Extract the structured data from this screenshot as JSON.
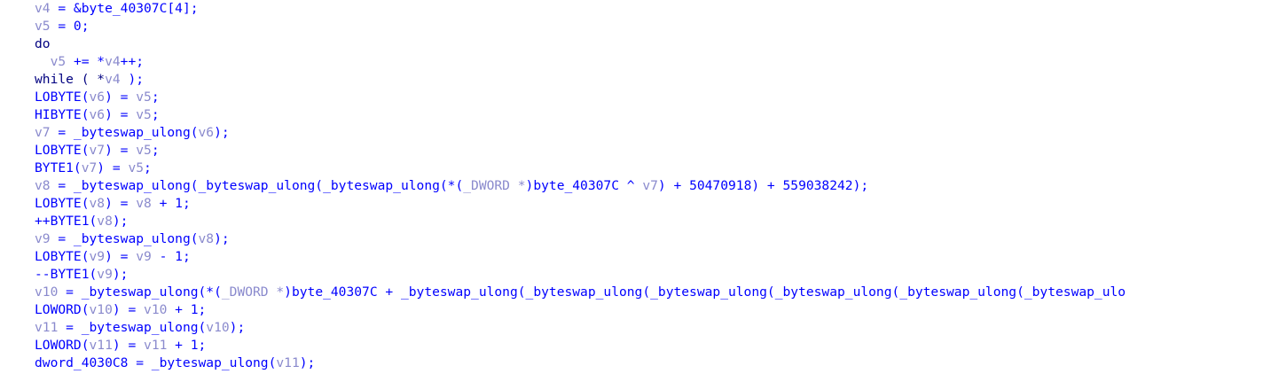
{
  "pseudocode": {
    "lines": [
      {
        "indent": "",
        "tokens": [
          {
            "t": "v4",
            "k": "local"
          },
          {
            "t": " = &byte_40307C[4];",
            "k": "var"
          }
        ]
      },
      {
        "indent": "",
        "tokens": [
          {
            "t": "v5",
            "k": "local"
          },
          {
            "t": " = 0;",
            "k": "var"
          }
        ]
      },
      {
        "indent": "",
        "tokens": [
          {
            "t": "do",
            "k": "kw"
          }
        ]
      },
      {
        "indent": "  ",
        "tokens": [
          {
            "t": "v5",
            "k": "local"
          },
          {
            "t": " += *",
            "k": "var"
          },
          {
            "t": "v4",
            "k": "local"
          },
          {
            "t": "++;",
            "k": "var"
          }
        ]
      },
      {
        "indent": "",
        "tokens": [
          {
            "t": "while ( *",
            "k": "kw"
          },
          {
            "t": "v4",
            "k": "local"
          },
          {
            "t": " );",
            "k": "var"
          }
        ]
      },
      {
        "indent": "",
        "tokens": [
          {
            "t": "LOBYTE(",
            "k": "var"
          },
          {
            "t": "v6",
            "k": "local"
          },
          {
            "t": ") = ",
            "k": "var"
          },
          {
            "t": "v5",
            "k": "local"
          },
          {
            "t": ";",
            "k": "var"
          }
        ]
      },
      {
        "indent": "",
        "tokens": [
          {
            "t": "HIBYTE(",
            "k": "var"
          },
          {
            "t": "v6",
            "k": "local"
          },
          {
            "t": ") = ",
            "k": "var"
          },
          {
            "t": "v5",
            "k": "local"
          },
          {
            "t": ";",
            "k": "var"
          }
        ]
      },
      {
        "indent": "",
        "tokens": [
          {
            "t": "v7",
            "k": "local"
          },
          {
            "t": " = _byteswap_ulong(",
            "k": "var"
          },
          {
            "t": "v6",
            "k": "local"
          },
          {
            "t": ");",
            "k": "var"
          }
        ]
      },
      {
        "indent": "",
        "tokens": [
          {
            "t": "LOBYTE(",
            "k": "var"
          },
          {
            "t": "v7",
            "k": "local"
          },
          {
            "t": ") = ",
            "k": "var"
          },
          {
            "t": "v5",
            "k": "local"
          },
          {
            "t": ";",
            "k": "var"
          }
        ]
      },
      {
        "indent": "",
        "tokens": [
          {
            "t": "BYTE1(",
            "k": "var"
          },
          {
            "t": "v7",
            "k": "local"
          },
          {
            "t": ") = ",
            "k": "var"
          },
          {
            "t": "v5",
            "k": "local"
          },
          {
            "t": ";",
            "k": "var"
          }
        ]
      },
      {
        "indent": "",
        "tokens": [
          {
            "t": "v8",
            "k": "local"
          },
          {
            "t": " = _byteswap_ulong(_byteswap_ulong(_byteswap_ulong(*(",
            "k": "var"
          },
          {
            "t": "_DWORD *",
            "k": "type"
          },
          {
            "t": ")byte_40307C ^ ",
            "k": "var"
          },
          {
            "t": "v7",
            "k": "local"
          },
          {
            "t": ") + 50470918) + 559038242);",
            "k": "var"
          }
        ]
      },
      {
        "indent": "",
        "tokens": [
          {
            "t": "LOBYTE(",
            "k": "var"
          },
          {
            "t": "v8",
            "k": "local"
          },
          {
            "t": ") = ",
            "k": "var"
          },
          {
            "t": "v8",
            "k": "local"
          },
          {
            "t": " + 1;",
            "k": "var"
          }
        ]
      },
      {
        "indent": "",
        "tokens": [
          {
            "t": "++BYTE1(",
            "k": "var"
          },
          {
            "t": "v8",
            "k": "local"
          },
          {
            "t": ");",
            "k": "var"
          }
        ]
      },
      {
        "indent": "",
        "tokens": [
          {
            "t": "v9",
            "k": "local"
          },
          {
            "t": " = _byteswap_ulong(",
            "k": "var"
          },
          {
            "t": "v8",
            "k": "local"
          },
          {
            "t": ");",
            "k": "var"
          }
        ]
      },
      {
        "indent": "",
        "tokens": [
          {
            "t": "LOBYTE(",
            "k": "var"
          },
          {
            "t": "v9",
            "k": "local"
          },
          {
            "t": ") = ",
            "k": "var"
          },
          {
            "t": "v9",
            "k": "local"
          },
          {
            "t": " - 1;",
            "k": "var"
          }
        ]
      },
      {
        "indent": "",
        "tokens": [
          {
            "t": "--BYTE1(",
            "k": "var"
          },
          {
            "t": "v9",
            "k": "local"
          },
          {
            "t": ");",
            "k": "var"
          }
        ]
      },
      {
        "indent": "",
        "tokens": [
          {
            "t": "v10",
            "k": "local"
          },
          {
            "t": " = _byteswap_ulong(*(",
            "k": "var"
          },
          {
            "t": "_DWORD *",
            "k": "type"
          },
          {
            "t": ")byte_40307C + _byteswap_ulong(_byteswap_ulong(_byteswap_ulong(_byteswap_ulong(_byteswap_ulong(_byteswap_ulo",
            "k": "var"
          }
        ]
      },
      {
        "indent": "",
        "tokens": [
          {
            "t": "LOWORD(",
            "k": "var"
          },
          {
            "t": "v10",
            "k": "local"
          },
          {
            "t": ") = ",
            "k": "var"
          },
          {
            "t": "v10",
            "k": "local"
          },
          {
            "t": " + 1;",
            "k": "var"
          }
        ]
      },
      {
        "indent": "",
        "tokens": [
          {
            "t": "v11",
            "k": "local"
          },
          {
            "t": " = _byteswap_ulong(",
            "k": "var"
          },
          {
            "t": "v10",
            "k": "local"
          },
          {
            "t": ");",
            "k": "var"
          }
        ]
      },
      {
        "indent": "",
        "tokens": [
          {
            "t": "LOWORD(",
            "k": "var"
          },
          {
            "t": "v11",
            "k": "local"
          },
          {
            "t": ") = ",
            "k": "var"
          },
          {
            "t": "v11",
            "k": "local"
          },
          {
            "t": " + 1;",
            "k": "var"
          }
        ]
      },
      {
        "indent": "",
        "tokens": [
          {
            "t": "dword_4030C8 = _byteswap_ulong(",
            "k": "var"
          },
          {
            "t": "v11",
            "k": "local"
          },
          {
            "t": ");",
            "k": "var"
          }
        ]
      }
    ]
  },
  "colors": {
    "background": "#ffffff",
    "identifier": "#0000ff",
    "local_variable": "#8a8acd",
    "type_cast": "#8a8acd",
    "keyword": "#000080"
  }
}
